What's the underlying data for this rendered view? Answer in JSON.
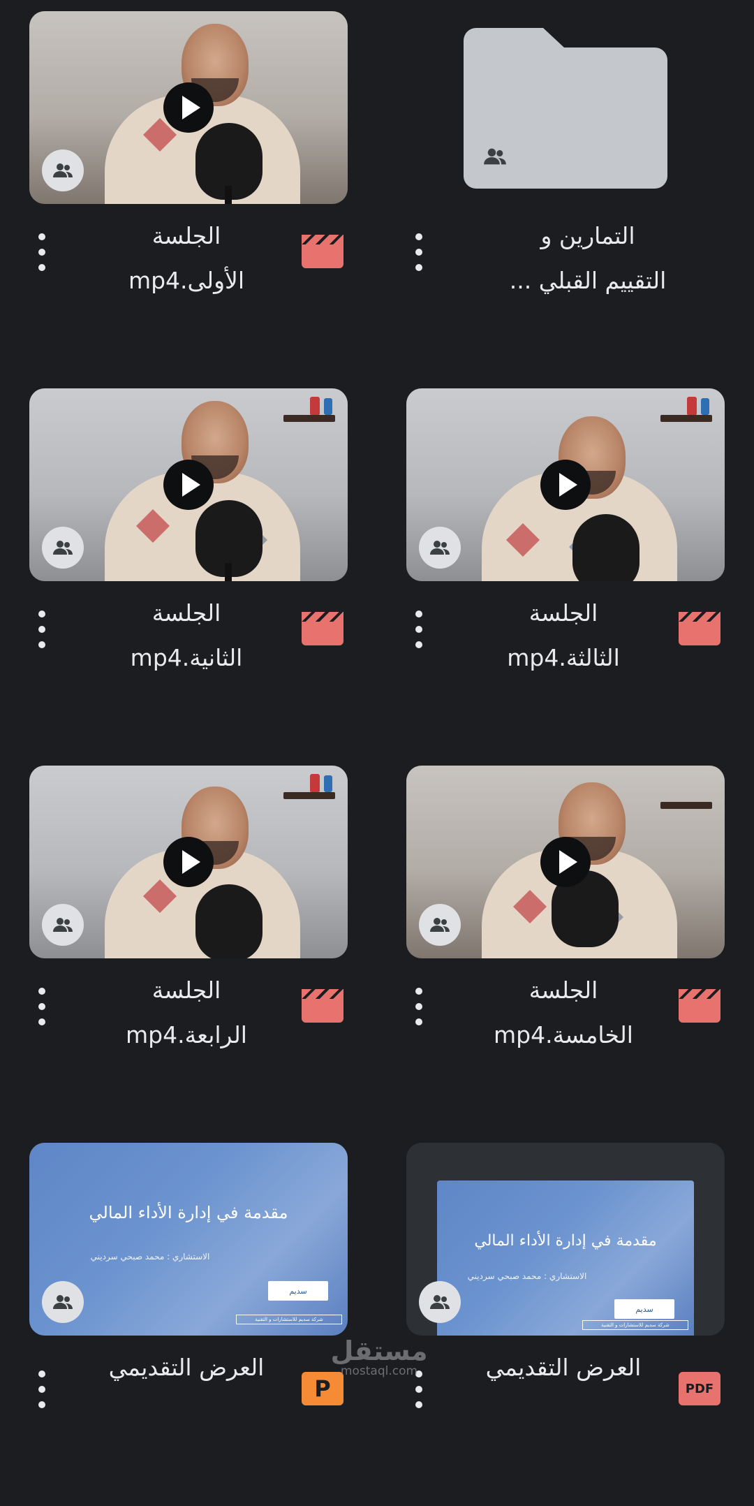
{
  "items": [
    {
      "line1": "الجلسة",
      "line2": "الأولى.mp4",
      "kind": "video",
      "shared_icon": "people-icon"
    },
    {
      "line1": "التمارين و",
      "line2": "التقييم القبلي ...",
      "kind": "folder",
      "shared_icon": "people-icon"
    },
    {
      "line1": "الجلسة",
      "line2": "الثانية.mp4",
      "kind": "video",
      "shared_icon": "people-icon"
    },
    {
      "line1": "الجلسة",
      "line2": "الثالثة.mp4",
      "kind": "video",
      "shared_icon": "people-icon"
    },
    {
      "line1": "الجلسة",
      "line2": "الرابعة.mp4",
      "kind": "video",
      "shared_icon": "people-icon"
    },
    {
      "line1": "الجلسة",
      "line2": "الخامسة.mp4",
      "kind": "video",
      "shared_icon": "people-icon"
    },
    {
      "line1": "العرض التقديمي",
      "line2": "",
      "kind": "powerpoint",
      "badge": "P",
      "shared_icon": "people-icon",
      "slide": {
        "title": "مقدمة في إدارة الأداء المالي",
        "subtitle": "الاستشاري : محمد صبحي سرديني",
        "logo": "سديم",
        "footer": "شركة سديم للاستشارات و التقنية"
      }
    },
    {
      "line1": "العرض التقديمي",
      "line2": "",
      "kind": "pdf",
      "badge": "PDF",
      "shared_icon": "people-icon",
      "slide": {
        "title": "مقدمة في إدارة الأداء المالي",
        "subtitle": "الاستشاري : محمد صبحي سرديني",
        "logo": "سديم",
        "footer": "شركة سديم للاستشارات و التقنية"
      }
    }
  ],
  "colors": {
    "background": "#1b1d21",
    "video_badge": "#e8726e",
    "ppt_badge": "#f58b35",
    "pdf_badge": "#e8726e",
    "folder": "#c4c7cc"
  },
  "watermark": {
    "arabic": "مستقل",
    "latin": "mostaql.com"
  }
}
